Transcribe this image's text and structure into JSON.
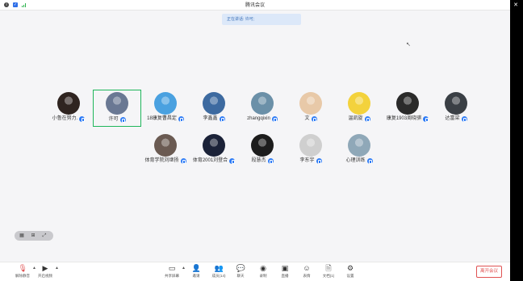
{
  "window": {
    "title": "腾讯会议"
  },
  "speaking": {
    "text": "正在讲话: 许可;"
  },
  "participants": [
    {
      "name": "小鲁在努力.",
      "avatar_color": "#2f2420",
      "active": false
    },
    {
      "name": "许可",
      "avatar_color": "#6a7893",
      "active": true
    },
    {
      "name": "18康复曹昌定",
      "avatar_color": "#4aa1e0",
      "active": false
    },
    {
      "name": "李鑫鑫",
      "avatar_color": "#3d6aa0",
      "active": false
    },
    {
      "name": "zhangqixin",
      "avatar_color": "#6b90a8",
      "active": false
    },
    {
      "name": "文",
      "avatar_color": "#e8c9a8",
      "active": false
    },
    {
      "name": "温凯旋",
      "avatar_color": "#f3d23c",
      "active": false
    },
    {
      "name": "康复1903周晓骐",
      "avatar_color": "#2a2a2a",
      "active": false
    },
    {
      "name": "达富梁",
      "avatar_color": "#3a3f45",
      "active": false
    },
    {
      "name": "体育学院刘继扬",
      "avatar_color": "#6a5a52",
      "active": false
    },
    {
      "name": "体育2001刘登合",
      "avatar_color": "#1b2238",
      "active": false
    },
    {
      "name": "段慧杰",
      "avatar_color": "#1c1c1c",
      "active": false
    },
    {
      "name": "李东宇",
      "avatar_color": "#cfcfcf",
      "active": false
    },
    {
      "name": "心理训练",
      "avatar_color": "#8fa8b8",
      "active": false
    }
  ],
  "toolbar": {
    "mute": "解除静音",
    "video": "开启视频",
    "share": "共享屏幕",
    "invite": "邀请",
    "members": "成员(14)",
    "chat": "聊天",
    "record": "录制",
    "live": "直播",
    "reactions": "表情",
    "docs": "文档(1)",
    "settings": "设置",
    "leave": "离开会议"
  },
  "icons": {
    "info": "info-icon",
    "shield": "shield-icon",
    "signal": "signal-icon",
    "minimize": "minimize-icon",
    "maximize": "maximize-icon",
    "close": "close-icon",
    "cursor": "cursor-icon"
  },
  "colors": {
    "active_border": "#1fb65b",
    "mic_blue": "#2e7cf6",
    "leave_red": "#e05252"
  }
}
